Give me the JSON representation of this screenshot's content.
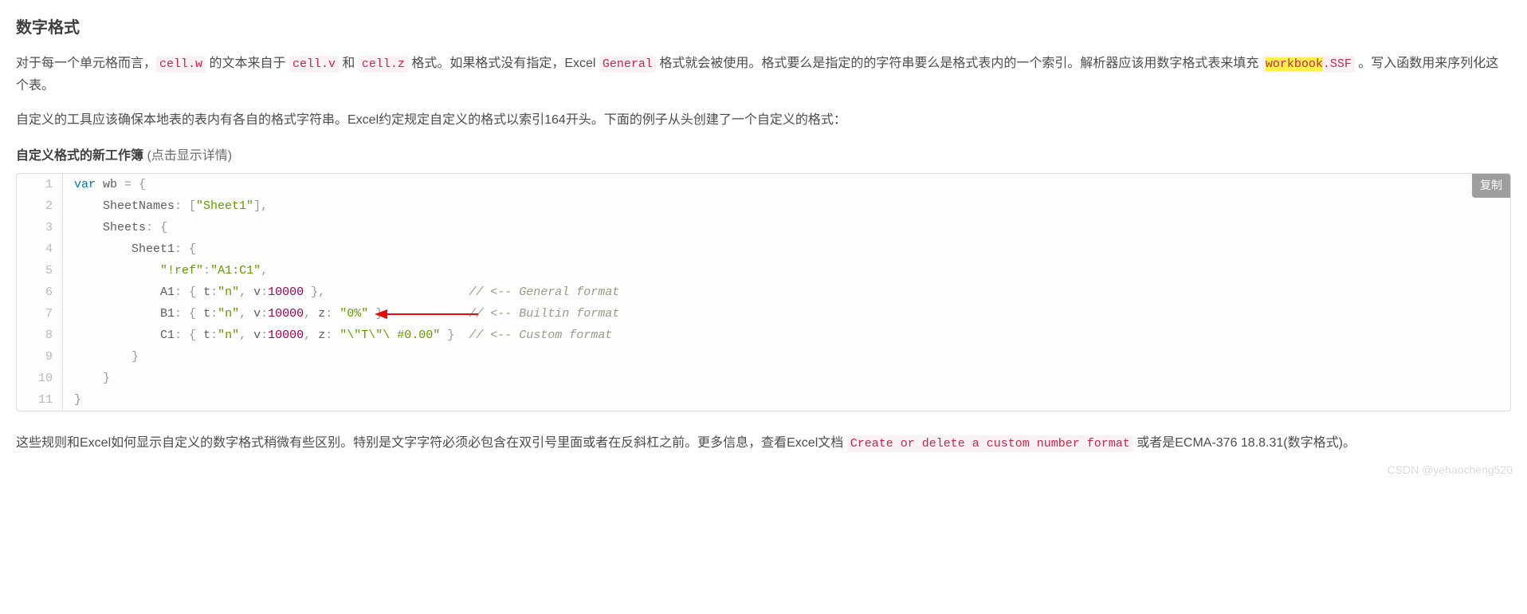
{
  "heading": "数字格式",
  "para1": {
    "t1": "对于每一个单元格而言，",
    "c1": "cell.w",
    "t2": " 的文本来自于 ",
    "c2": "cell.v",
    "t3": " 和 ",
    "c3": "cell.z",
    "t4": " 格式。如果格式没有指定，Excel ",
    "c4": "General",
    "t5": " 格式就会被使用。格式要么是指定的的字符串要么是格式表内的一个索引。解析器应该用数字格式表来填充 ",
    "c5a": "workbook",
    "c5b": ".SSF",
    "t6": " 。写入函数用来序列化这个表。"
  },
  "para2": "自定义的工具应该确保本地表的表内有各自的格式字符串。Excel约定规定自定义的格式以索引164开头。下面的例子从头创建了一个自定义的格式：",
  "subtitle": {
    "bold": "自定义格式的新工作簿",
    "hint": " (点击显示详情)"
  },
  "copy_label": "复制",
  "code": {
    "line_numbers": [
      "1",
      "2",
      "3",
      "4",
      "5",
      "6",
      "7",
      "8",
      "9",
      "10",
      "11"
    ],
    "l1": {
      "kw": "var",
      "id": " wb ",
      "pun1": "= {"
    },
    "l2": {
      "pad": "    ",
      "prop": "SheetNames",
      "pun1": ": [",
      "str": "\"Sheet1\"",
      "pun2": "],"
    },
    "l3": {
      "pad": "    ",
      "prop": "Sheets",
      "pun1": ": {"
    },
    "l4": {
      "pad": "        ",
      "prop": "Sheet1",
      "pun1": ": {"
    },
    "l5": {
      "pad": "            ",
      "str1": "\"!ref\"",
      "pun1": ":",
      "str2": "\"A1:C1\"",
      "pun2": ","
    },
    "l6": {
      "pad": "            ",
      "prop": "A1",
      "pun1": ": { ",
      "p2": "t",
      "pun2": ":",
      "str": "\"n\"",
      "pun3": ", ",
      "p3": "v",
      "pun4": ":",
      "num": "10000",
      "pun5": " },",
      "sp": "                    ",
      "cmt": "// <-- General format"
    },
    "l7": {
      "pad": "            ",
      "prop": "B1",
      "pun1": ": { ",
      "p2": "t",
      "pun2": ":",
      "str": "\"n\"",
      "pun3": ", ",
      "p3": "v",
      "pun4": ":",
      "num": "10000",
      "pun5": ", ",
      "p4": "z",
      "pun6": ": ",
      "str2": "\"0%\"",
      "pun7": " },",
      "sp": "           ",
      "cmt": "// <-- Builtin format"
    },
    "l8": {
      "pad": "            ",
      "prop": "C1",
      "pun1": ": { ",
      "p2": "t",
      "pun2": ":",
      "str": "\"n\"",
      "pun3": ", ",
      "p3": "v",
      "pun4": ":",
      "num": "10000",
      "pun5": ", ",
      "p4": "z",
      "pun6": ": ",
      "str2": "\"\\\"T\\\"\\ #0.00\"",
      "pun7": " }",
      "sp": "  ",
      "cmt": "// <-- Custom format"
    },
    "l9": {
      "pad": "        ",
      "pun": "}"
    },
    "l10": {
      "pad": "    ",
      "pun": "}"
    },
    "l11": {
      "pun": "}"
    }
  },
  "para3": {
    "t1": "这些规则和Excel如何显示自定义的数字格式稍微有些区别。特别是文字字符必须必包含在双引号里面或者在反斜杠之前。更多信息，查看Excel文档 ",
    "c1": "Create or delete a custom number format",
    "t2": " 或者是ECMA-376 18.8.31(数字格式)。"
  },
  "watermark": "CSDN @yehaocheng520"
}
